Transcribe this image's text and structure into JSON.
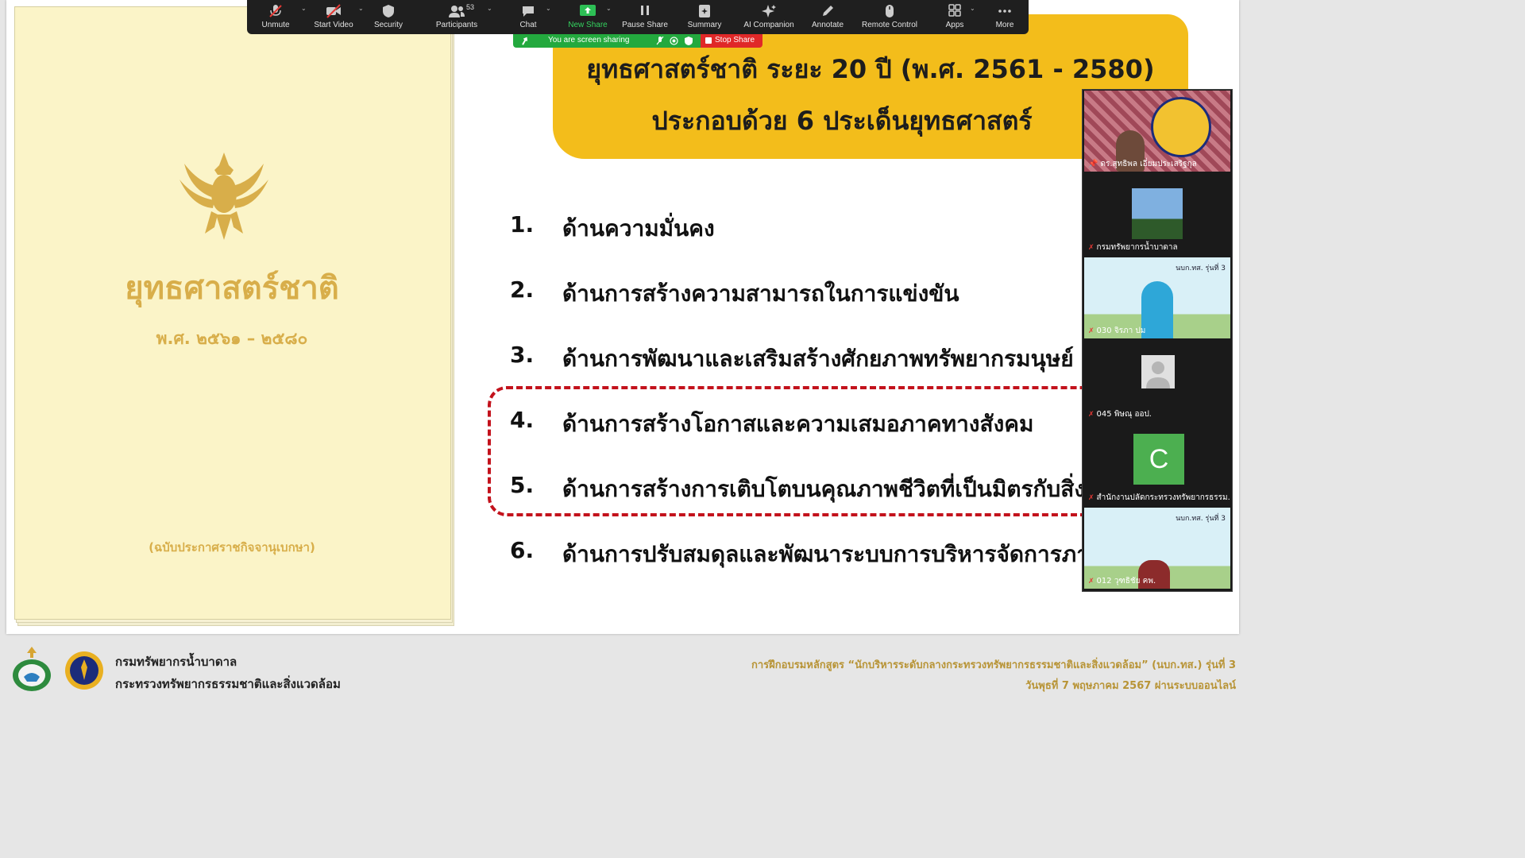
{
  "zoom_toolbar": {
    "items": [
      {
        "label": "Unmute",
        "icon": "mic-muted-icon"
      },
      {
        "label": "Start Video",
        "icon": "video-off-icon"
      },
      {
        "label": "Security",
        "icon": "shield-icon"
      },
      {
        "label": "Participants",
        "icon": "participants-icon",
        "count": "53"
      },
      {
        "label": "Chat",
        "icon": "chat-icon"
      },
      {
        "label": "New Share",
        "icon": "share-arrow-icon"
      },
      {
        "label": "Pause Share",
        "icon": "pause-icon"
      },
      {
        "label": "Summary",
        "icon": "summary-icon"
      },
      {
        "label": "AI Companion",
        "icon": "sparkle-icon"
      },
      {
        "label": "Annotate",
        "icon": "pen-icon"
      },
      {
        "label": "Remote Control",
        "icon": "mouse-icon"
      },
      {
        "label": "Apps",
        "icon": "apps-icon"
      },
      {
        "label": "More",
        "icon": "more-dots-icon"
      }
    ],
    "sharing_status": "You are screen sharing",
    "stop_share_label": "Stop Share",
    "colors": {
      "new_share": "#2dbf55",
      "stop_share": "#e02828",
      "share_bar": "#23a93e"
    }
  },
  "slide": {
    "book": {
      "title": "ยุทธศาสตร์ชาติ",
      "years": "พ.ศ. ๒๕๖๑ – ๒๕๘๐",
      "edition": "(ฉบับประกาศราชกิจจานุเบกษา)"
    },
    "banner": {
      "line1": "ยุทธศาสตร์ชาติ ระยะ 20 ปี (พ.ศ. 2561 - 2580)",
      "line2": "ประกอบด้วย 6 ประเด็นยุทธศาสตร์"
    },
    "strategies": [
      {
        "num": "1.",
        "text": "ด้านความมั่นคง"
      },
      {
        "num": "2.",
        "text": "ด้านการสร้างความสามารถในการแข่งขัน"
      },
      {
        "num": "3.",
        "text": "ด้านการพัฒนาและเสริมสร้างศักยภาพทรัพยากรมนุษย์"
      },
      {
        "num": "4.",
        "text": "ด้านการสร้างโอกาสและความเสมอภาคทางสังคม"
      },
      {
        "num": "5.",
        "text": "ด้านการสร้างการเติบโตบนคุณภาพชีวิตที่เป็นมิตรกับสิ่งแวดล้อม"
      },
      {
        "num": "6.",
        "text": "ด้านการปรับสมดุลและพัฒนาระบบการบริหารจัดการภาครัฐ"
      }
    ]
  },
  "participants": [
    {
      "name": "ดร.สุทธิพล เอี่ยมประเสริฐกุล",
      "pinned": true
    },
    {
      "name": "กรมทรัพยากรน้ำบาดาล"
    },
    {
      "name": "030 จิรภา  ปม",
      "overlay": "นบก.ทส. รุ่นที่ 3"
    },
    {
      "name": "045 พิษณุ ออป."
    },
    {
      "name": "สำนักงานปลัดกระทรวงทรัพยากรธรรม...",
      "avatar_letter": "C"
    },
    {
      "name": "012 วุฑธิชัย คพ.",
      "overlay": "นบก.ทส. รุ่นที่ 3"
    }
  ],
  "footer": {
    "org_line1": "กรมทรัพยากรน้ำบาดาล",
    "org_line2": "กระทรวงทรัพยากรธรรมชาติและสิ่งแวดล้อม",
    "course_line1": "การฝึกอบรมหลักสูตร “นักบริหารระดับกลางกระทรวงทรัพยากรธรรมชาติและสิ่งแวดล้อม” (นบก.ทส.) รุ่นที่ 3",
    "course_line2": "วันพุธที่ 7 พฤษภาคม 2567 ผ่านระบบออนไลน์"
  }
}
